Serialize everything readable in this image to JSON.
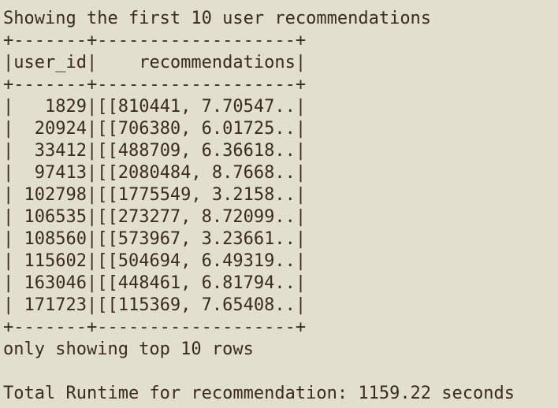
{
  "console": {
    "header": "Showing the first 10 user recommendations",
    "border": "+-------+-------------------+",
    "table": {
      "columns": [
        "user_id",
        "recommendations"
      ],
      "rows": [
        {
          "user_id": "1829",
          "recommendations": "[[810441, 7.70547..."
        },
        {
          "user_id": "20924",
          "recommendations": "[[706380, 6.01725..."
        },
        {
          "user_id": "33412",
          "recommendations": "[[488709, 6.36618..."
        },
        {
          "user_id": "97413",
          "recommendations": "[[2080484, 8.7668..."
        },
        {
          "user_id": "102798",
          "recommendations": "[[1775549, 3.2158..."
        },
        {
          "user_id": "106535",
          "recommendations": "[[273277, 8.72099..."
        },
        {
          "user_id": "108560",
          "recommendations": "[[573967, 3.23661..."
        },
        {
          "user_id": "115602",
          "recommendations": "[[504694, 6.49319..."
        },
        {
          "user_id": "163046",
          "recommendations": "[[448461, 6.81794..."
        },
        {
          "user_id": "171723",
          "recommendations": "[[115369, 7.65408..."
        }
      ]
    },
    "footer": "only showing top 10 rows",
    "runtime": "Total Runtime for recommendation: 1159.22 seconds"
  }
}
